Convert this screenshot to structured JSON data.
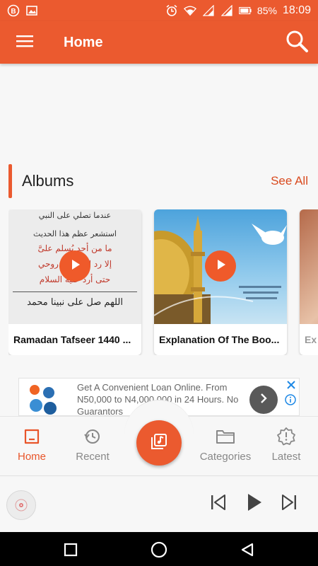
{
  "status_bar": {
    "battery_percent": "85%",
    "time": "18:09",
    "icons": [
      "b-notification-icon",
      "image-icon",
      "alarm-icon",
      "wifi-icon",
      "signal-icon",
      "signal-icon-2",
      "battery-icon"
    ]
  },
  "app_bar": {
    "title": "Home",
    "menu_icon": "hamburger-menu-icon",
    "search_icon": "search-icon",
    "color": "#eb5a2f"
  },
  "albums_section": {
    "title": "Albums",
    "see_all_label": "See All",
    "cards": [
      {
        "title": "Ramadan Tafseer 1440 ...",
        "image_text_lines": [
          "عندما تصلي على النبي",
          "استشعر عظم هذا الحديث",
          "ما من أحد يُسلم علىَّ",
          "إلا رد الله علىَّ روحي",
          "حتى أرد عليه السلام",
          "اللهم صل على نبينا محمد"
        ]
      },
      {
        "title": "Explanation Of The Boo...",
        "image_text_lines": []
      },
      {
        "title": "Ex",
        "image_text_lines": []
      }
    ]
  },
  "ad": {
    "text": "Get A Convenient Loan Online. From N50,000 to N4,000,000 in 24 Hours. No Guarantors",
    "close_icon": "close-icon",
    "info_icon": "info-icon",
    "arrow_icon": "chevron-right-icon"
  },
  "bottom_nav": {
    "items": [
      {
        "label": "Home",
        "icon": "home-icon",
        "active": true
      },
      {
        "label": "Recent",
        "icon": "history-icon",
        "active": false
      },
      {
        "label": "Categories",
        "icon": "folder-icon",
        "active": false
      },
      {
        "label": "Latest",
        "icon": "latest-badge-icon",
        "active": false
      }
    ],
    "center_button_icon": "music-library-icon",
    "active_color": "#e8552a"
  },
  "player": {
    "disc_icon": "disc-icon",
    "prev_icon": "skip-previous-icon",
    "play_icon": "play-icon",
    "next_icon": "skip-next-icon"
  },
  "system_nav": {
    "icons": [
      "recents-square-icon",
      "home-circle-icon",
      "back-triangle-icon"
    ]
  }
}
